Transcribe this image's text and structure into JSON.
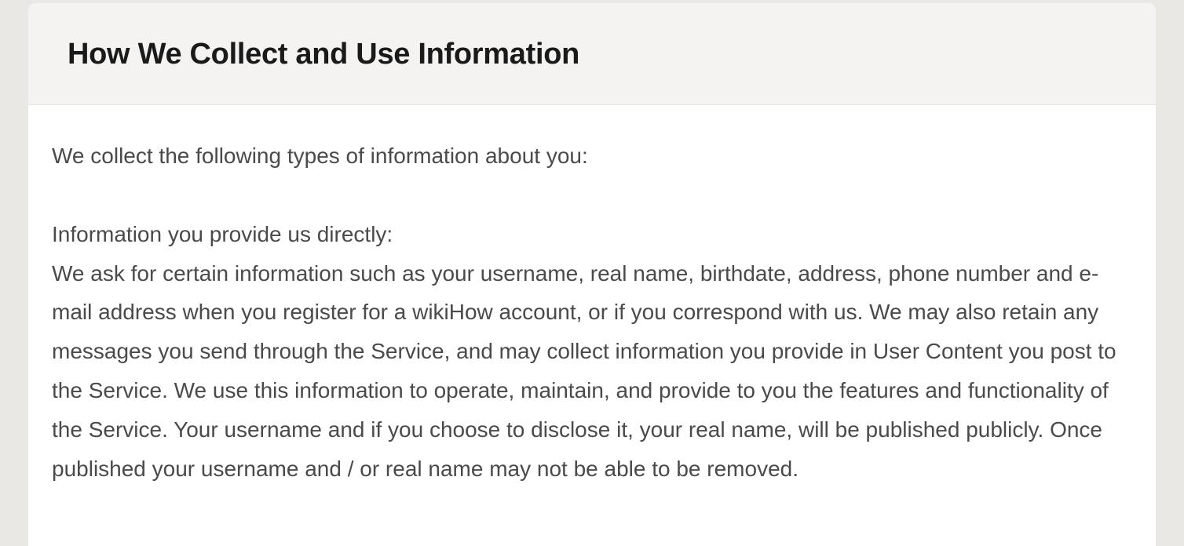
{
  "section": {
    "title": "How We Collect and Use Information",
    "intro": "We collect the following types of information about you:",
    "subheading": "Information you provide us directly:",
    "body": "We ask for certain information such as your username, real name, birthdate, address, phone number and e-mail address when you register for a wikiHow account, or if you correspond with us. We may also retain any messages you send through the Service, and may collect information you provide in User Content you post to the Service. We use this information to operate, maintain, and provide to you the features and functionality of the Service. Your username and if you choose to disclose it, your real name, will be published publicly. Once published your username and / or real name may not be able to be removed."
  }
}
